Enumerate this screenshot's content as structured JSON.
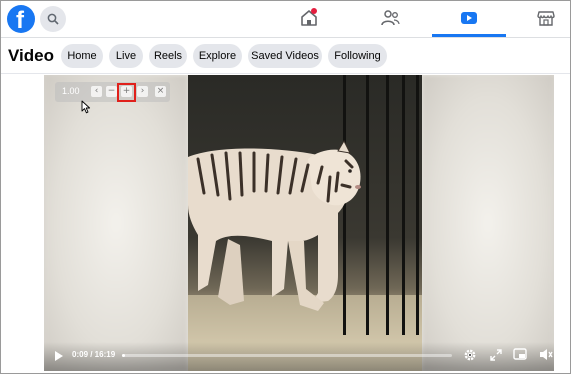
{
  "nav": {
    "logo_letter": "f",
    "tabs": [
      {
        "name": "home",
        "active": false,
        "has_notification": true
      },
      {
        "name": "friends",
        "active": false
      },
      {
        "name": "video",
        "active": true
      },
      {
        "name": "marketplace",
        "active": false
      }
    ]
  },
  "video_page": {
    "title": "Video",
    "filters": [
      "Home",
      "Live",
      "Reels",
      "Explore",
      "Saved Videos",
      "Following"
    ]
  },
  "zoom_control": {
    "value": "1.00",
    "buttons": [
      "reset",
      "zoom-out",
      "zoom-in",
      "fit",
      "close"
    ],
    "highlighted": "zoom-in"
  },
  "player": {
    "time": "0:09 / 16:19",
    "progress": 0.01
  },
  "colors": {
    "brand": "#1877f2",
    "notification": "#e41e3f",
    "highlight": "#e0201b"
  }
}
